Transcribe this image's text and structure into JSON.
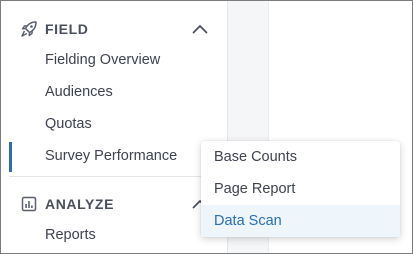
{
  "sidebar": {
    "field_section": {
      "label": "FIELD",
      "icon": "rocket-icon",
      "expanded": true,
      "items": [
        {
          "label": "Fielding Overview"
        },
        {
          "label": "Audiences"
        },
        {
          "label": "Quotas"
        },
        {
          "label": "Survey Performance",
          "active": true
        }
      ]
    },
    "analyze_section": {
      "label": "ANALYZE",
      "icon": "bar-chart-icon",
      "items": [
        {
          "label": "Reports"
        }
      ]
    }
  },
  "flyout_menu": {
    "items": [
      {
        "label": "Base Counts"
      },
      {
        "label": "Page Report"
      },
      {
        "label": "Data Scan",
        "highlighted": true
      }
    ]
  },
  "colors": {
    "accent": "#2a6fb0",
    "text": "#3e4350",
    "header_text": "#4a4f5c",
    "highlight_bg": "#eef5fb"
  }
}
